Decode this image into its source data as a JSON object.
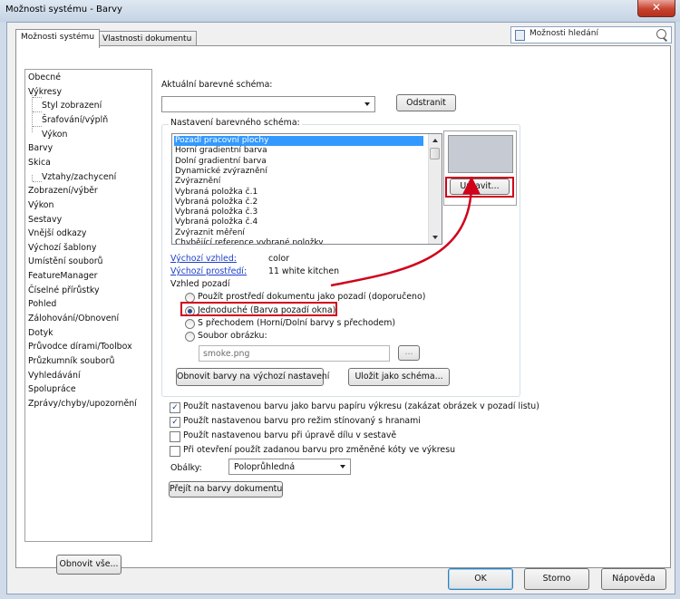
{
  "window": {
    "title": "Možnosti systému - Barvy",
    "close_glyph": "✕"
  },
  "tabs": [
    {
      "label": "Možnosti systému",
      "active": true
    },
    {
      "label": "Vlastnosti dokumentu",
      "active": false
    }
  ],
  "search": {
    "label": "Možnosti hledání"
  },
  "tree": {
    "items": [
      {
        "label": "Obecné",
        "level": 0
      },
      {
        "label": "Výkresy",
        "level": 0
      },
      {
        "label": "Styl zobrazení",
        "level": 1
      },
      {
        "label": "Šrafování/výplň",
        "level": 1
      },
      {
        "label": "Výkon",
        "level": 1
      },
      {
        "label": "Barvy",
        "level": 0
      },
      {
        "label": "Skica",
        "level": 0
      },
      {
        "label": "Vztahy/zachycení",
        "level": 1
      },
      {
        "label": "Zobrazení/výběr",
        "level": 0
      },
      {
        "label": "Výkon",
        "level": 0
      },
      {
        "label": "Sestavy",
        "level": 0
      },
      {
        "label": "Vnější odkazy",
        "level": 0
      },
      {
        "label": "Výchozí šablony",
        "level": 0
      },
      {
        "label": "Umístění souborů",
        "level": 0
      },
      {
        "label": "FeatureManager",
        "level": 0
      },
      {
        "label": "Číselné přírůstky",
        "level": 0
      },
      {
        "label": "Pohled",
        "level": 0
      },
      {
        "label": "Zálohování/Obnovení",
        "level": 0
      },
      {
        "label": "Dotyk",
        "level": 0
      },
      {
        "label": "Průvodce dírami/Toolbox",
        "level": 0
      },
      {
        "label": "Průzkumník souborů",
        "level": 0
      },
      {
        "label": "Vyhledávání",
        "level": 0
      },
      {
        "label": "Spolupráce",
        "level": 0
      },
      {
        "label": "Zprávy/chyby/upozornění",
        "level": 0
      }
    ],
    "reset_all_label": "Obnovit vše..."
  },
  "scheme": {
    "current_label": "Aktuální barevné schéma:",
    "current_value": "",
    "delete_label": "Odstranit",
    "settings_label": "Nastavení barevného schéma:",
    "items": [
      "Pozadí pracovní plochy",
      "Horní gradientní barva",
      "Dolní gradientní barva",
      "Dynamické zvýraznění",
      "Zvýraznění",
      "Vybraná položka č.1",
      "Vybraná položka č.2",
      "Vybraná položka č.3",
      "Vybraná položka č.4",
      "Zvýraznit měření",
      "Chybějící reference vybrané položky"
    ],
    "selected_index": 0,
    "edit_label": "Upravit...",
    "swatch_color": "#c5cad3",
    "default_appearance_label": "Výchozí vzhled:",
    "default_appearance_value": "color",
    "default_scene_label": "Výchozí prostředí:",
    "default_scene_value": "11 white kitchen",
    "background_label": "Vzhled pozadí",
    "background_options": [
      "Použít prostředí dokumentu jako pozadí (doporučeno)",
      "Jednoduché (Barva pozadí okna)",
      "S přechodem (Horní/Dolní barvy s přechodem)",
      "Soubor obrázku:"
    ],
    "background_selected_index": 1,
    "image_file_value": "smoke.png",
    "browse_label": "...",
    "restore_defaults_label": "Obnovit barvy na výchozí nastavení",
    "save_scheme_label": "Uložit jako schéma..."
  },
  "checkboxes": [
    {
      "label": "Použít nastavenou barvu jako barvu papíru výkresu (zakázat obrázek v pozadí listu)",
      "checked": true
    },
    {
      "label": "Použít nastavenou barvu pro režim stínovaný s hranami",
      "checked": true
    },
    {
      "label": "Použít nastavenou barvu při úpravě dílu v sestavě",
      "checked": false
    },
    {
      "label": "Při otevření použít zadanou barvu pro změněné kóty ve výkresu",
      "checked": false
    }
  ],
  "envelopes": {
    "label": "Obálky:",
    "value": "Poloprůhledná"
  },
  "document_colors_label": "Přejít na barvy dokumentu",
  "footer": {
    "ok_label": "OK",
    "cancel_label": "Storno",
    "help_label": "Nápověda"
  },
  "colors": {
    "annotation": "#d0021b",
    "selection": "#3399ff",
    "link": "#1e3fc8"
  }
}
